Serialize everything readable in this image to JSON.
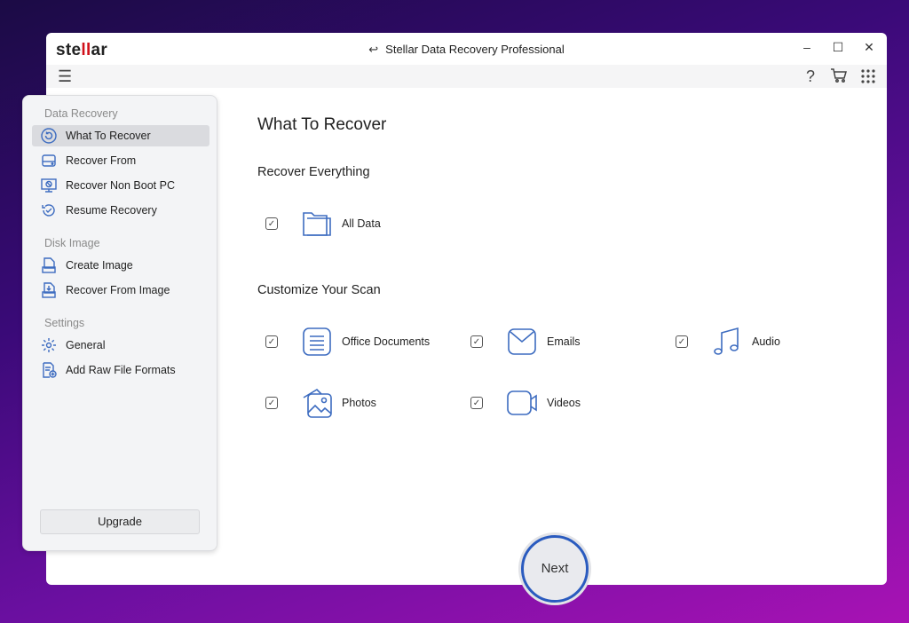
{
  "window": {
    "logo": "stellar",
    "title": "Stellar Data Recovery Professional"
  },
  "toolbar": {
    "help": "?"
  },
  "sidebar": {
    "sections": [
      {
        "label": "Data Recovery",
        "items": [
          {
            "label": "What To Recover"
          },
          {
            "label": "Recover From"
          },
          {
            "label": "Recover Non Boot PC"
          },
          {
            "label": "Resume Recovery"
          }
        ]
      },
      {
        "label": "Disk Image",
        "items": [
          {
            "label": "Create Image"
          },
          {
            "label": "Recover From Image"
          }
        ]
      },
      {
        "label": "Settings",
        "items": [
          {
            "label": "General"
          },
          {
            "label": "Add Raw File Formats"
          }
        ]
      }
    ],
    "upgrade": "Upgrade"
  },
  "main": {
    "title": "What To Recover",
    "everything_heading": "Recover Everything",
    "all_data": {
      "label": "All Data",
      "checked": true
    },
    "customize_heading": "Customize Your Scan",
    "options": [
      {
        "label": "Office Documents",
        "checked": true
      },
      {
        "label": "Emails",
        "checked": true
      },
      {
        "label": "Audio",
        "checked": true
      },
      {
        "label": "Photos",
        "checked": true
      },
      {
        "label": "Videos",
        "checked": true
      }
    ],
    "next": "Next"
  },
  "colors": {
    "accent": "#2a5bbf",
    "icon": "#3d6cc0"
  }
}
